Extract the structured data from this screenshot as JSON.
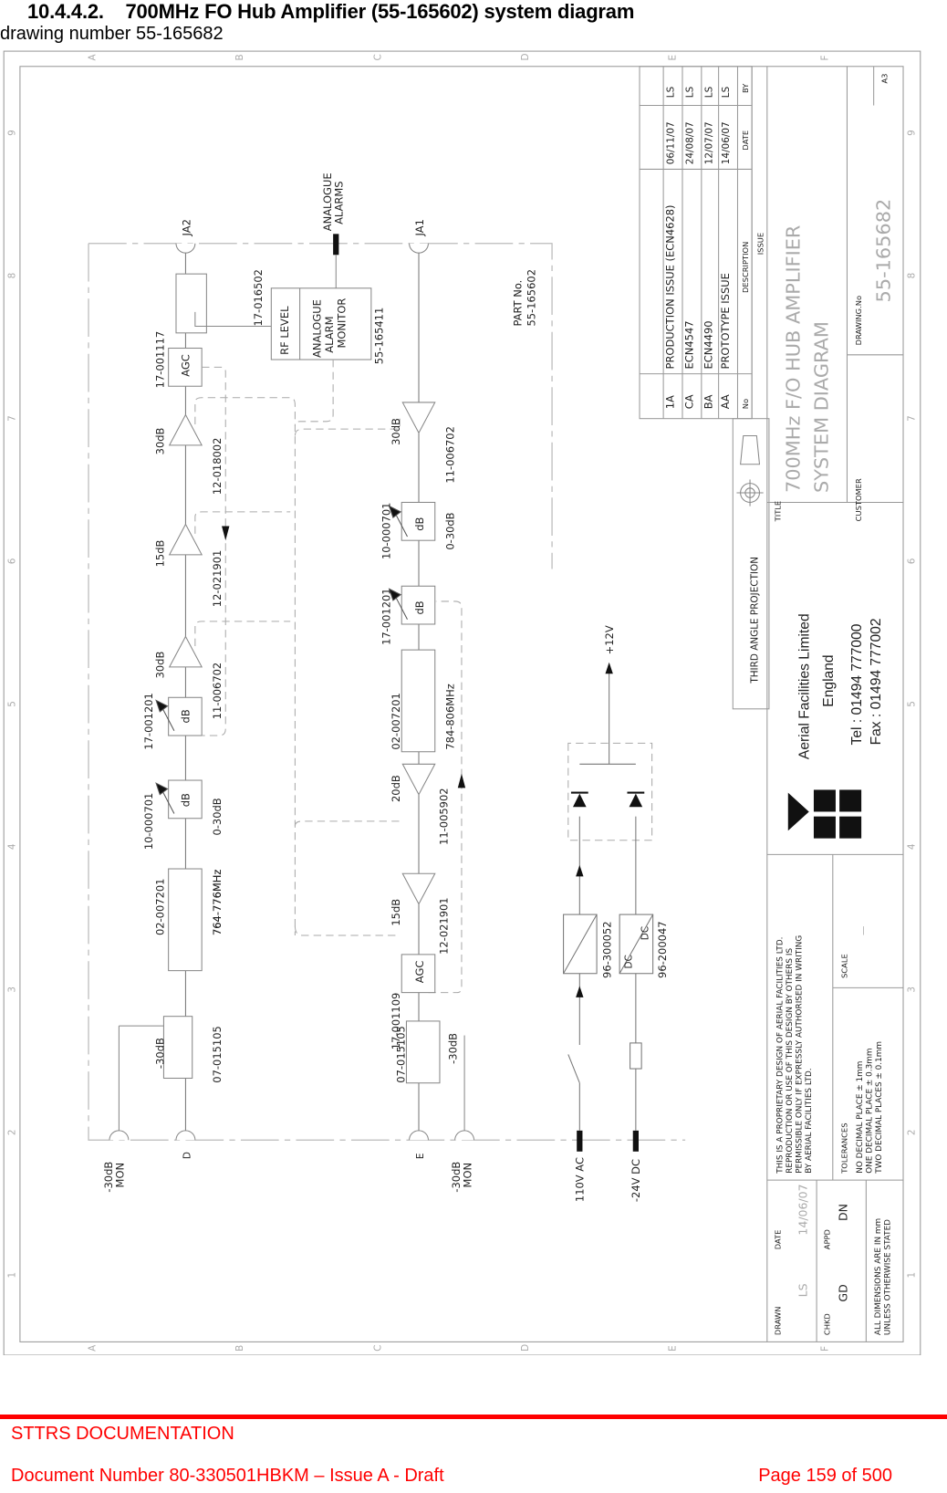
{
  "header": {
    "section_title": "10.4.4.2.    700MHz FO Hub Amplifier (55-165602) system diagram",
    "subtitle": "drawing number 55-165682"
  },
  "frame": {
    "column_letters": [
      "A",
      "B",
      "C",
      "D",
      "E",
      "F"
    ],
    "row_numbers": [
      "9",
      "8",
      "7",
      "6",
      "5",
      "4",
      "3",
      "2",
      "1"
    ]
  },
  "diagram": {
    "ports": {
      "ja2": "JA2",
      "ja1": "JA1",
      "d": "D",
      "e": "E",
      "mon_d": [
        "-30dB",
        "MON"
      ],
      "mon_e": [
        "-30dB",
        "MON"
      ],
      "analogue_alarms": [
        "ANALOGUE",
        "ALARMS"
      ],
      "ac_in": "110V AC",
      "dc_in": "-24V DC",
      "v12": "+12V"
    },
    "part_no": [
      "PART No.",
      "55-165602"
    ],
    "upper_chain": [
      {
        "type": "coupler",
        "part": "07-015105",
        "label": "-30dB"
      },
      {
        "type": "filter",
        "part": "02-007201",
        "label": "764-776MHz"
      },
      {
        "type": "attenuator",
        "part": "10-000701",
        "label": "0-30dB",
        "inner": "dB"
      },
      {
        "type": "attenuator",
        "part": "17-001201",
        "label": "",
        "inner": "dB"
      },
      {
        "type": "amplifier",
        "part": "11-006702",
        "label": "30dB"
      },
      {
        "type": "amplifier",
        "part": "12-021901",
        "label": "15dB"
      },
      {
        "type": "amplifier",
        "part": "12-018002",
        "label": "30dB"
      },
      {
        "type": "agc",
        "part": "17-001117",
        "label": "",
        "inner": "AGC"
      },
      {
        "type": "coupler",
        "part": "17-016502",
        "label": ""
      }
    ],
    "lower_chain": [
      {
        "type": "coupler",
        "part": "07-015105",
        "label": "-30dB"
      },
      {
        "type": "agc",
        "part": "17-001109",
        "label": "",
        "inner": "AGC"
      },
      {
        "type": "amplifier",
        "part": "12-021901",
        "label": "15dB"
      },
      {
        "type": "amplifier",
        "part": "11-005902",
        "label": "20dB"
      },
      {
        "type": "filter",
        "part": "02-007201",
        "label": "784-806MHz"
      },
      {
        "type": "attenuator",
        "part": "17-001201",
        "label": "",
        "inner": "dB"
      },
      {
        "type": "attenuator",
        "part": "10-000701",
        "label": "0-30dB",
        "inner": "dB"
      },
      {
        "type": "amplifier",
        "part": "11-006702",
        "label": "30dB"
      }
    ],
    "alarm_monitor": {
      "rf_level": "RF LEVEL",
      "lines": [
        "ANALOGUE",
        "ALARM",
        "MONITOR"
      ],
      "part": "55-165411"
    },
    "power": {
      "psu_part": "96-300052",
      "dcdc_part": "96-200047",
      "dc_in_label": "DC",
      "dc_out_label": "DC"
    }
  },
  "title_block": {
    "revisions": [
      {
        "no": "1A",
        "description": "PRODUCTION ISSUE (ECN4628)",
        "date": "06/11/07",
        "by": "LS"
      },
      {
        "no": "CA",
        "description": "ECN4547",
        "date": "24/08/07",
        "by": "LS"
      },
      {
        "no": "BA",
        "description": "ECN4490",
        "date": "12/07/07",
        "by": "LS"
      },
      {
        "no": "AA",
        "description": "PROTOTYPE ISSUE",
        "date": "14/06/07",
        "by": "LS"
      }
    ],
    "rev_headers": {
      "no": "No",
      "description": "DESCRIPTION",
      "date": "DATE",
      "by": "BY",
      "issue": "ISSUE"
    },
    "sheet_size": "A3",
    "projection": "THIRD ANGLE PROJECTION",
    "title_label": "TITLE",
    "title_lines": [
      "700MHz F/O HUB AMPLIFIER",
      "SYSTEM DIAGRAM"
    ],
    "customer_label": "CUSTOMER",
    "drawing_no_label": "DRAWING.No",
    "drawing_no": "55-165682",
    "company": {
      "name": "Aerial Facilities Limited",
      "country": "England",
      "tel": "Tel : 01494 777000",
      "fax": "Fax : 01494 777002"
    },
    "copyright": [
      "THIS IS A PROPRIETARY DESIGN OF AERIAL FACILITIES LTD.",
      "REPRODUCTION OR USE OF THIS DESIGN BY OTHERS IS",
      "PERMISSIBLE ONLY IF EXPRESSLY AUTHORISED IN WRITING",
      "BY AERIAL FACILITIES LTD."
    ],
    "scale_label": "SCALE",
    "scale_value": "—",
    "tolerances_label": "TOLERANCES",
    "tolerances": [
      "NO DECIMAL PLACE ± 1mm",
      "ONE DECIMAL PLACE ± 0.3mm",
      "TWO DECIMAL PLACES ± 0.1mm"
    ],
    "drawn_label": "DRAWN",
    "drawn_by": "LS",
    "date_label": "DATE",
    "date_value": "14/06/07",
    "chkd_label": "CHKD",
    "chkd_by": "GD",
    "appd_label": "APPD",
    "appd_by": "DN",
    "dimensions_note": [
      "ALL DIMENSIONS ARE IN mm",
      "UNLESS OTHERWISE STATED"
    ]
  },
  "footer": {
    "org": "STTRS DOCUMENTATION",
    "document": "Document Number 80-330501HBKM – Issue A - Draft",
    "page": "Page 159 of 500"
  }
}
